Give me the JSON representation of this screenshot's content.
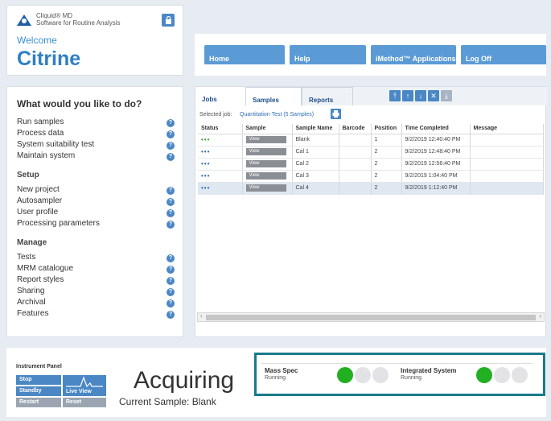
{
  "header": {
    "app_name": "Cliquid® MD",
    "app_tagline": "Software for Routine Analysis",
    "welcome": "Welcome",
    "user": "Citrine"
  },
  "nav": {
    "tabs": [
      {
        "label": "Home"
      },
      {
        "label": "Help"
      },
      {
        "label": "iMethod™ Applications"
      },
      {
        "label": "Log Off"
      }
    ]
  },
  "menu": {
    "title": "What would you like to do?",
    "items_top": [
      "Run samples",
      "Process data",
      "System suitability test",
      "Maintain system"
    ],
    "setup_title": "Setup",
    "setup_items": [
      "New project",
      "Autosampler",
      "User profile",
      "Processing parameters"
    ],
    "manage_title": "Manage",
    "manage_items": [
      "Tests",
      "MRM catalogue",
      "Report styles",
      "Sharing",
      "Archival",
      "Features"
    ],
    "help_glyph": "?"
  },
  "samples": {
    "tabs": [
      "Jobs",
      "Samples",
      "Reports"
    ],
    "selected_job_label": "Selected job:",
    "selected_job_value": "Quantitation Test (5 Samples)",
    "columns": [
      "Status",
      "Sample",
      "Sample Name",
      "Barcode",
      "Position",
      "Time Completed",
      "Message"
    ],
    "view_label": "View",
    "rows": [
      {
        "status": "•••",
        "name": "Blank",
        "barcode": "",
        "position": "1",
        "time": "9/2/2019 12:40:40 PM",
        "message": ""
      },
      {
        "status": "•••",
        "name": "Cal 1",
        "barcode": "",
        "position": "2",
        "time": "9/2/2019 12:48:40 PM",
        "message": ""
      },
      {
        "status": "•••",
        "name": "Cal 2",
        "barcode": "",
        "position": "2",
        "time": "9/2/2019 12:56:40 PM",
        "message": ""
      },
      {
        "status": "•••",
        "name": "Cal 3",
        "barcode": "",
        "position": "2",
        "time": "9/2/2019 1:04:40 PM",
        "message": ""
      },
      {
        "status": "•••",
        "name": "Cal 4",
        "barcode": "",
        "position": "2",
        "time": "9/2/2019 1:12:40 PM",
        "message": ""
      }
    ]
  },
  "instrument": {
    "title": "Instrument Panel",
    "stop": "Stop",
    "standby": "Standby",
    "restart": "Restart",
    "live_view": "Live View",
    "reset": "Reset",
    "state": "Acquiring",
    "current_sample": "Current Sample: Blank",
    "mass_spec_name": "Mass Spec",
    "mass_spec_state": "Running",
    "integrated_name": "Integrated System",
    "integrated_state": "Running"
  },
  "colors": {
    "accent": "#4a87c4",
    "status_green": "#22b022",
    "status_box_border": "#1a7a8a"
  }
}
